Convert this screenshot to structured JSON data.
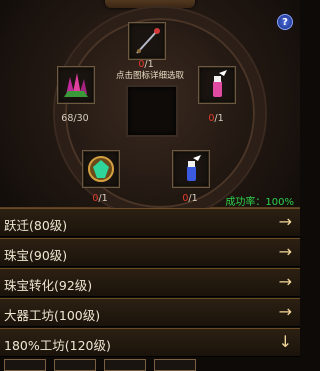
{
  "synthesis": {
    "hint": "点击图标详细选取",
    "help_label": "?",
    "success_rate": "成功率：100%",
    "slots": {
      "top": {
        "icon": "staff-weapon-icon",
        "have": "0",
        "need": "/1"
      },
      "left": {
        "icon": "magenta-crystal-icon",
        "have": "68",
        "need": "/30"
      },
      "right": {
        "icon": "pink-potion-icon",
        "have": "0",
        "need": "/1"
      },
      "bottom_left": {
        "icon": "green-gem-icon",
        "have": "0",
        "need": "/1"
      },
      "bottom_right": {
        "icon": "blue-potion-icon",
        "have": "0",
        "need": "/1"
      }
    }
  },
  "menu": [
    {
      "label": "跃迁(80级)",
      "arrow": "→"
    },
    {
      "label": "珠宝(90级)",
      "arrow": "→"
    },
    {
      "label": "珠宝转化(92级)",
      "arrow": "→"
    },
    {
      "label": "大器工坊(100级)",
      "arrow": "→"
    },
    {
      "label": "180%工坊(120级)",
      "arrow": "↓"
    }
  ],
  "colors": {
    "success": "#2ed14a",
    "missing": "#e43b2c",
    "arrow": "#f3d79a"
  }
}
